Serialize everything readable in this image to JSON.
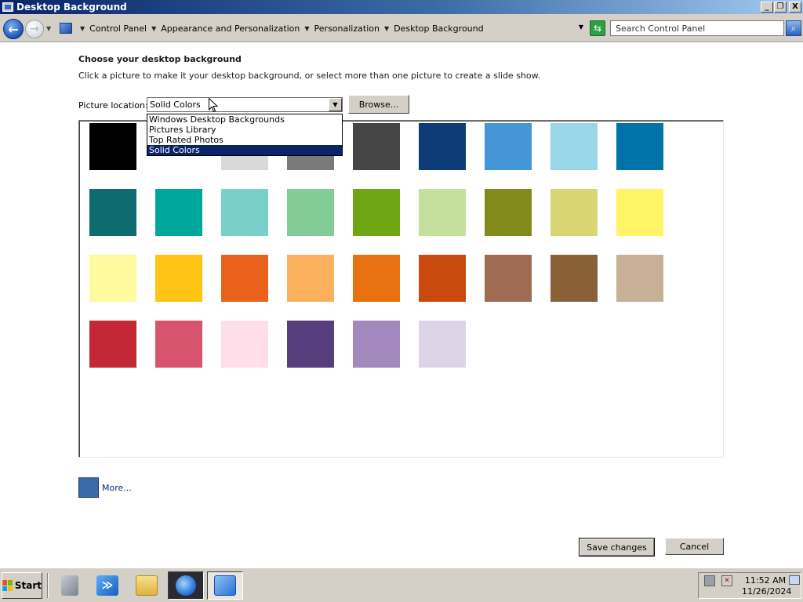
{
  "window": {
    "title": "Desktop Background",
    "buttons": {
      "minimize": "_",
      "restore": "❐",
      "close": "X"
    }
  },
  "addressbar": {
    "breadcrumbs": [
      "Control Panel",
      "Appearance and Personalization",
      "Personalization",
      "Desktop Background"
    ],
    "search_placeholder": "Search Control Panel"
  },
  "page": {
    "heading": "Choose your desktop background",
    "subtext": "Click a picture to make it your desktop background, or select more than one picture to create a slide show.",
    "location_label": "Picture location:",
    "location_value": "Solid Colors",
    "browse_label": "Browse...",
    "location_options": [
      "Windows Desktop Backgrounds",
      "Pictures Library",
      "Top Rated Photos",
      "Solid Colors"
    ],
    "selected_option_index": 3,
    "more_label": "More...",
    "more_color": "#3a6aa8",
    "save_label": "Save changes",
    "cancel_label": "Cancel"
  },
  "colors": [
    "#000000",
    "#ffffff",
    "#d9d9d9",
    "#7a7a7a",
    "#454545",
    "#0d3c78",
    "#4596d6",
    "#99d6e8",
    "#0074a8",
    "#0e6b70",
    "#00a89c",
    "#78d0c8",
    "#82cc98",
    "#6fa614",
    "#c4e09c",
    "#828a1c",
    "#d8d672",
    "#fff466",
    "#fffa9e",
    "#ffc414",
    "#eb621c",
    "#fab05c",
    "#e97210",
    "#c94a0c",
    "#a06c54",
    "#8a6038",
    "#c8b098",
    "#c42836",
    "#d8546e",
    "#ffdeea",
    "#563f7c",
    "#a288bc",
    "#dcd4e6"
  ],
  "taskbar": {
    "start_label": "Start",
    "apps": [
      "server-manager",
      "powershell",
      "explorer",
      "internet-explorer",
      "control-panel"
    ],
    "clock_time": "11:52 AM",
    "clock_date": "11/26/2024"
  }
}
